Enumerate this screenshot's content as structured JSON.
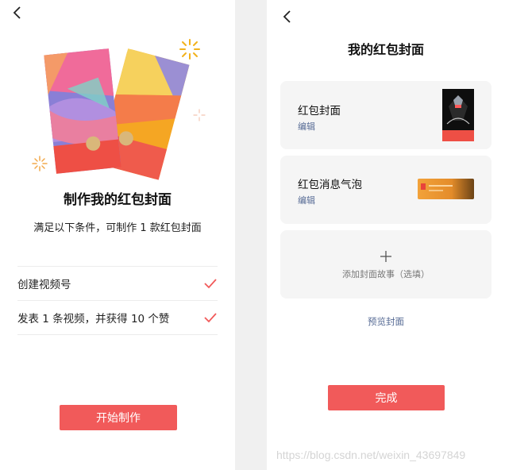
{
  "left_screen": {
    "title": "制作我的红包封面",
    "subtitle": "满足以下条件，可制作 1 款红包封面",
    "conditions": [
      {
        "label": "创建视频号",
        "done": true
      },
      {
        "label": "发表 1 条视频，并获得 10 个赞",
        "done": true
      }
    ],
    "start_button": "开始制作"
  },
  "right_screen": {
    "title": "我的红包封面",
    "cover_card": {
      "title": "红包封面",
      "edit": "编辑"
    },
    "bubble_card": {
      "title": "红包消息气泡",
      "edit": "编辑"
    },
    "add_story": "添加封面故事（选填）",
    "preview_link": "预览封面",
    "done_button": "完成"
  },
  "watermark": "https://blog.csdn.net/weixin_43697849",
  "colors": {
    "accent": "#f15a5a",
    "link": "#576b95",
    "card_bg": "#f5f5f5"
  }
}
